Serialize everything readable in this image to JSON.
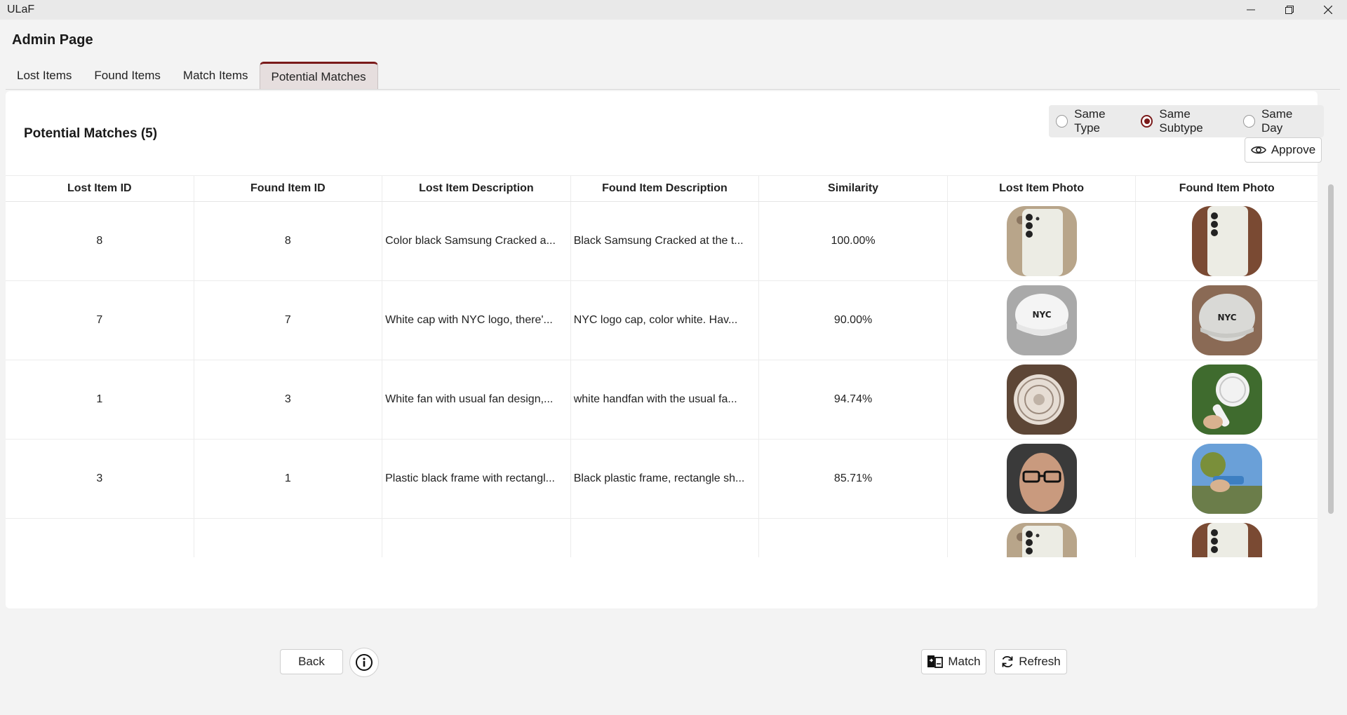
{
  "window": {
    "title": "ULaF",
    "minimize": "minimize",
    "restore": "restore",
    "close": "close"
  },
  "page": {
    "title": "Admin Page"
  },
  "tabs": [
    {
      "label": "Lost Items"
    },
    {
      "label": "Found Items"
    },
    {
      "label": "Match Items"
    },
    {
      "label": "Potential Matches",
      "active": true
    }
  ],
  "section": {
    "title": "Potential Matches (5)"
  },
  "filters": {
    "options": [
      {
        "label": "Same Type",
        "checked": false
      },
      {
        "label": "Same Subtype",
        "checked": true
      },
      {
        "label": "Same Day",
        "checked": false
      }
    ]
  },
  "approve": {
    "label": "Approve",
    "icon": "eye-icon"
  },
  "table": {
    "headers": [
      "Lost Item ID",
      "Found Item ID",
      "Lost Item Description",
      "Found Item Description",
      "Similarity",
      "Lost Item Photo",
      "Found Item Photo"
    ],
    "rows": [
      {
        "lost_id": "8",
        "found_id": "8",
        "lost_desc": "Color black Samsung Cracked a...",
        "found_desc": "Black Samsung Cracked at the t...",
        "similarity": "100.00%",
        "lost_photo": "phone-photo",
        "found_photo": "phone-photo"
      },
      {
        "lost_id": "7",
        "found_id": "7",
        "lost_desc": "White cap with NYC logo, there'...",
        "found_desc": "NYC logo cap, color white. Hav...",
        "similarity": "90.00%",
        "lost_photo": "cap-photo",
        "found_photo": "cap-photo"
      },
      {
        "lost_id": "1",
        "found_id": "3",
        "lost_desc": "White fan with usual fan design,...",
        "found_desc": "white handfan with the usual fa...",
        "similarity": "94.74%",
        "lost_photo": "fan-photo",
        "found_photo": "fan-photo"
      },
      {
        "lost_id": "3",
        "found_id": "1",
        "lost_desc": "Plastic black frame with rectangl...",
        "found_desc": "Black plastic frame, rectangle sh...",
        "similarity": "85.71%",
        "lost_photo": "glasses-photo",
        "found_photo": "glasses-photo"
      },
      {
        "lost_id": "",
        "found_id": "",
        "lost_desc": "",
        "found_desc": "",
        "similarity": "",
        "lost_photo": "phone-photo",
        "found_photo": "phone-photo"
      }
    ]
  },
  "buttons": {
    "back": "Back",
    "info_icon": "info-icon",
    "match": "Match",
    "match_icon": "match-icon",
    "refresh": "Refresh",
    "refresh_icon": "refresh-icon"
  },
  "colors": {
    "accent": "#7a1a1a",
    "background": "#f3f3f3",
    "panel": "#ffffff"
  }
}
